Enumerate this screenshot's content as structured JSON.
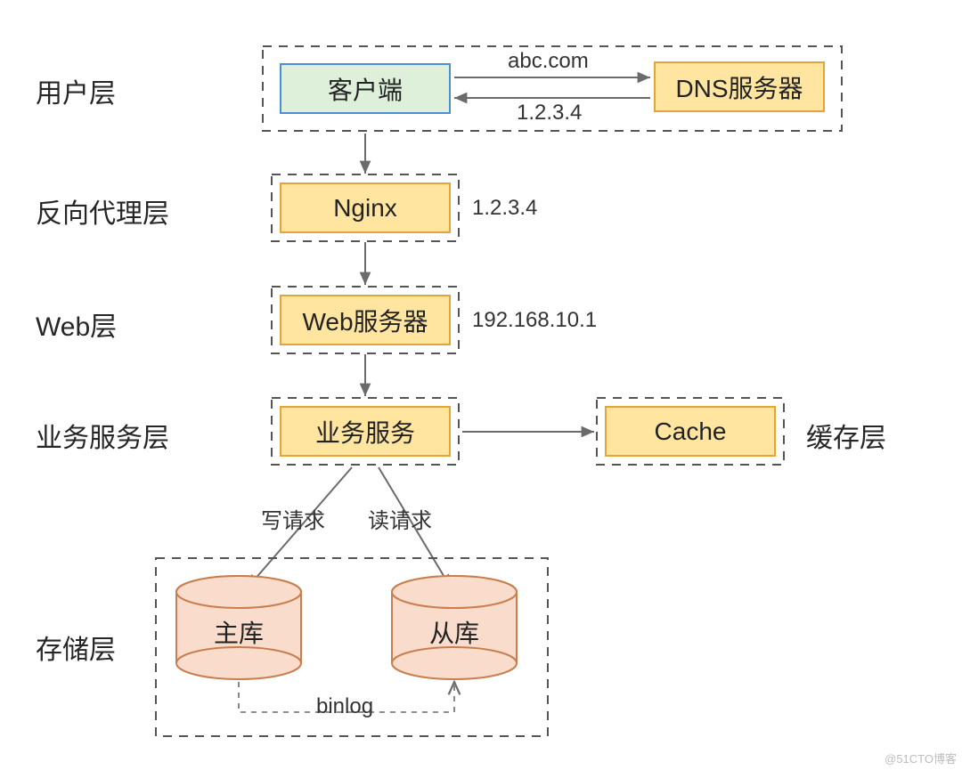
{
  "layers": {
    "user": {
      "label": "用户层"
    },
    "proxy": {
      "label": "反向代理层"
    },
    "web": {
      "label": "Web层"
    },
    "service": {
      "label": "业务服务层"
    },
    "cache": {
      "label": "缓存层"
    },
    "storage": {
      "label": "存储层"
    }
  },
  "nodes": {
    "client": {
      "label": "客户端"
    },
    "dns": {
      "label": "DNS服务器"
    },
    "nginx": {
      "label": "Nginx",
      "ip": "1.2.3.4"
    },
    "web": {
      "label": "Web服务器",
      "ip": "192.168.10.1"
    },
    "biz": {
      "label": "业务服务"
    },
    "cache": {
      "label": "Cache"
    },
    "master_db": {
      "label": "主库"
    },
    "slave_db": {
      "label": "从库"
    }
  },
  "edges": {
    "client_dns_req": {
      "label": "abc.com"
    },
    "client_dns_resp": {
      "label": "1.2.3.4"
    },
    "write": {
      "label": "写请求"
    },
    "read": {
      "label": "读请求"
    },
    "binlog": {
      "label": "binlog"
    }
  },
  "watermark": "@51CTO博客"
}
